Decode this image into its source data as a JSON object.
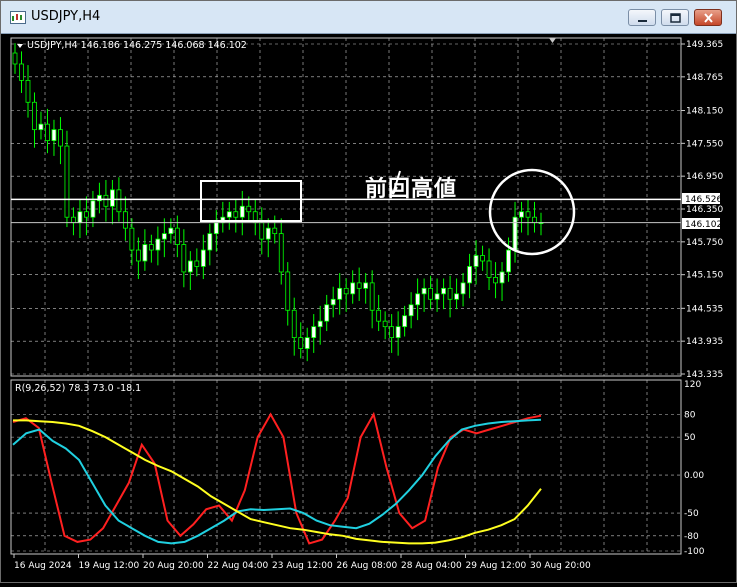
{
  "window": {
    "title": "USDJPY,H4"
  },
  "main_chart": {
    "header": "USDJPY,H4  146.186 146.275 146.068 146.102",
    "price_ticks": [
      "149.365",
      "148.765",
      "148.150",
      "147.550",
      "146.950",
      "146.350",
      "145.750",
      "145.150",
      "144.535",
      "143.935",
      "143.335"
    ],
    "hline_label": "146.526",
    "price_label": "146.102",
    "annotation": "前回高値"
  },
  "indicator": {
    "header": "R(9,26,52) 78.3 73.0 -18.1",
    "ticks": [
      "120",
      "80",
      "50",
      "0.00",
      "-50",
      "-80",
      "-100"
    ]
  },
  "time_axis": [
    "16 Aug 2024",
    "19 Aug 12:00",
    "20 Aug 20:00",
    "22 Aug 04:00",
    "23 Aug 12:00",
    "26 Aug 08:00",
    "28 Aug 04:00",
    "29 Aug 12:00",
    "30 Aug 20:00"
  ],
  "colors": {
    "background": "#000000",
    "grid": "#c8c8c8",
    "bull_candle": "#ffffff",
    "bear_candle": "#000000",
    "candle_wick": "#00ff00",
    "line_red": "#ff2020",
    "line_cyan": "#20d0e0",
    "line_yellow": "#ffff20"
  },
  "chart_data": [
    {
      "type": "candlestick",
      "title": "USDJPY,H4",
      "ylim": [
        143.335,
        149.365
      ],
      "reference_line": 146.526,
      "last_price": 146.102,
      "close_series": [
        149.0,
        148.7,
        148.3,
        147.8,
        147.9,
        147.6,
        147.8,
        147.5,
        146.2,
        146.1,
        146.3,
        146.2,
        146.5,
        146.6,
        146.4,
        146.7,
        146.3,
        146.0,
        145.6,
        145.4,
        145.7,
        145.6,
        145.8,
        145.9,
        146.0,
        145.7,
        145.2,
        145.4,
        145.3,
        145.6,
        145.9,
        146.1,
        146.2,
        146.3,
        146.2,
        146.4,
        146.3,
        146.1,
        145.8,
        146.0,
        145.9,
        145.2,
        144.5,
        144.0,
        143.8,
        144.0,
        144.2,
        144.3,
        144.6,
        144.7,
        144.9,
        144.8,
        145.0,
        144.9,
        145.0,
        144.5,
        144.3,
        144.2,
        144.0,
        144.2,
        144.4,
        144.6,
        144.8,
        144.9,
        144.7,
        144.8,
        144.9,
        144.7,
        144.8,
        145.0,
        145.3,
        145.5,
        145.4,
        145.1,
        145.0,
        145.2,
        145.6,
        146.2,
        146.3,
        146.2,
        146.1,
        146.102
      ]
    },
    {
      "type": "line",
      "title": "R(9,26,52)",
      "ylim": [
        -100,
        120
      ],
      "series": [
        {
          "name": "78.3",
          "color": "#ff2020",
          "values": [
            70,
            75,
            62,
            -10,
            -80,
            -88,
            -85,
            -70,
            -40,
            -10,
            40,
            15,
            -60,
            -80,
            -65,
            -45,
            -40,
            -60,
            -20,
            50,
            80,
            50,
            -50,
            -90,
            -85,
            -60,
            -30,
            50,
            80,
            10,
            -50,
            -70,
            -60,
            10,
            50,
            60,
            55,
            60,
            65,
            70,
            75,
            78.3
          ]
        },
        {
          "name": "73.0",
          "color": "#20d0e0",
          "values": [
            40,
            55,
            60,
            45,
            35,
            20,
            -10,
            -40,
            -60,
            -70,
            -80,
            -88,
            -90,
            -88,
            -80,
            -70,
            -60,
            -48,
            -45,
            -46,
            -45,
            -44,
            -50,
            -60,
            -66,
            -68,
            -70,
            -64,
            -52,
            -38,
            -20,
            0,
            25,
            45,
            60,
            65,
            68,
            70,
            71,
            72,
            73.0
          ]
        },
        {
          "name": "-18.1",
          "color": "#ffff20",
          "values": [
            72,
            72,
            71,
            70,
            68,
            65,
            58,
            50,
            40,
            30,
            20,
            12,
            5,
            -5,
            -15,
            -28,
            -38,
            -48,
            -58,
            -62,
            -66,
            -70,
            -72,
            -75,
            -78,
            -80,
            -84,
            -86,
            -88,
            -89,
            -90,
            -90,
            -89,
            -86,
            -82,
            -76,
            -72,
            -66,
            -58,
            -40,
            -18.1
          ]
        }
      ]
    }
  ]
}
